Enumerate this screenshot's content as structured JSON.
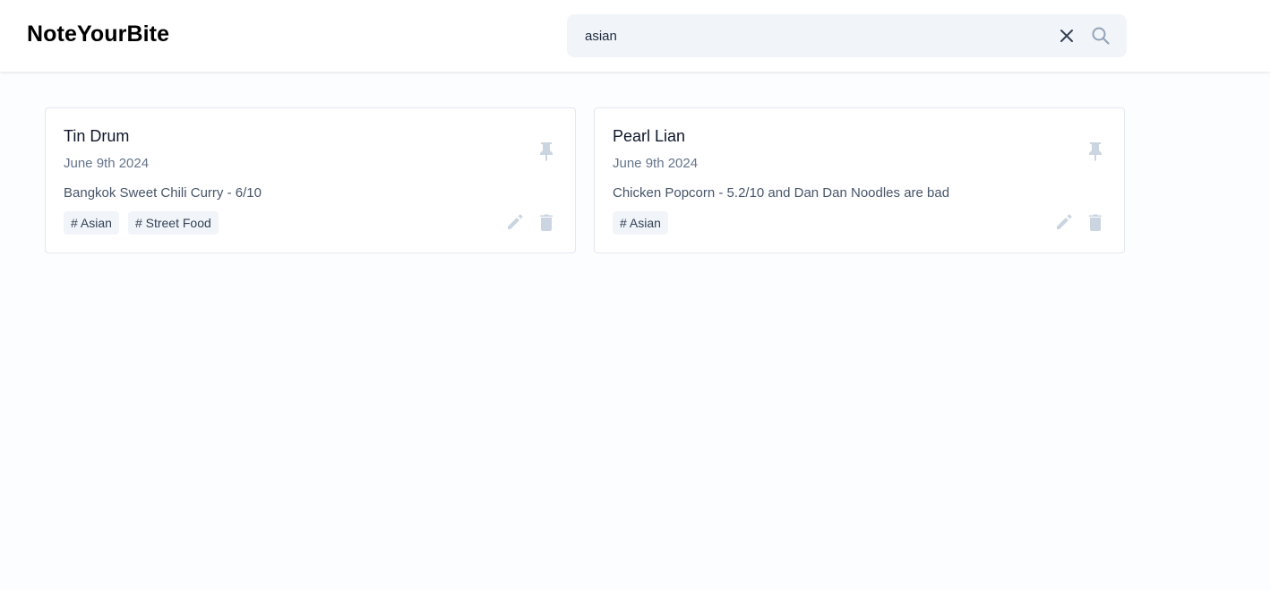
{
  "app": {
    "brand": "NoteYourBite"
  },
  "search": {
    "value": "asian",
    "placeholder": "Search Notes"
  },
  "icons": {
    "clear": "close-icon",
    "search": "search-icon",
    "pin": "pin-icon",
    "edit": "pencil-icon",
    "delete": "trash-icon"
  },
  "colors": {
    "background": "#fcfdfe",
    "card_border": "#e2e8f0",
    "search_bg": "#f1f5f9",
    "icon_muted": "#cbd5e1",
    "text_secondary": "#64748b"
  },
  "notes": [
    {
      "title": "Tin Drum",
      "date": "June 9th 2024",
      "content": "Bangkok Sweet Chili Curry - 6/10",
      "tags": [
        "# Asian",
        "# Street Food"
      ]
    },
    {
      "title": "Pearl Lian",
      "date": "June 9th 2024",
      "content": "Chicken Popcorn - 5.2/10 and Dan Dan Noodles are bad",
      "tags": [
        "# Asian"
      ]
    }
  ]
}
